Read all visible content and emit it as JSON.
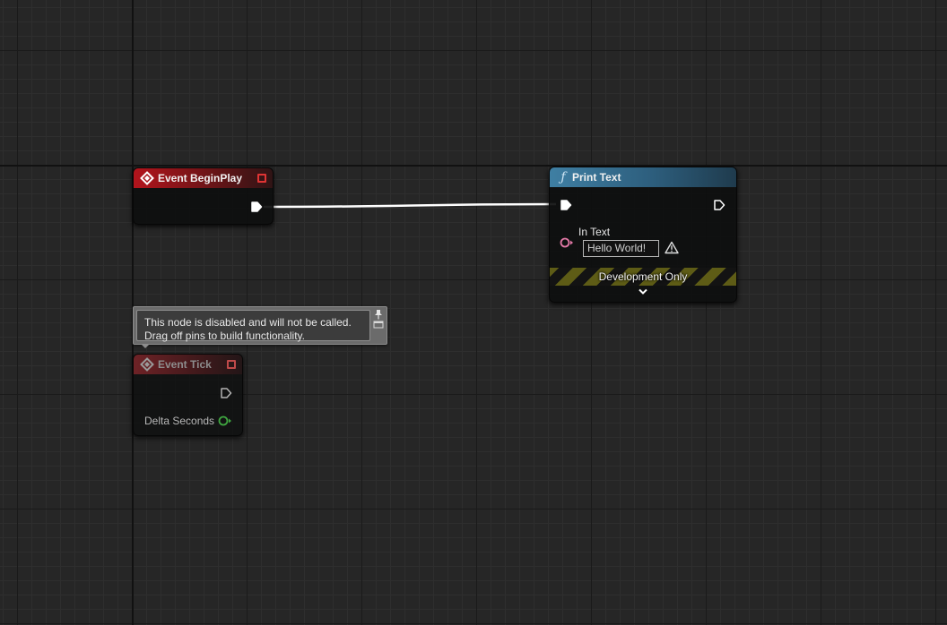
{
  "nodes": {
    "begin_play": {
      "title": "Event BeginPlay",
      "icon": "event-diamond-icon",
      "header_color": "#b3141c"
    },
    "print_text": {
      "title": "Print Text",
      "icon": "function-icon",
      "function_glyph": "ƒ",
      "header_color": "#3f7fa3",
      "in_text_label": "In Text",
      "in_text_value": "Hello World!",
      "banner": "Development Only"
    },
    "event_tick": {
      "title": "Event Tick",
      "icon": "event-diamond-icon",
      "header_color": "#6e2226",
      "delta_seconds_label": "Delta Seconds"
    }
  },
  "tooltip": {
    "text": "This node is disabled and will not be called.\nDrag off pins to build functionality."
  },
  "colors": {
    "exec_wire": "#ffffff",
    "text_pin": "#e57aa8",
    "float_pin": "#3fa640",
    "delegate_pin": "#e03434",
    "warning": "#dddddd"
  }
}
